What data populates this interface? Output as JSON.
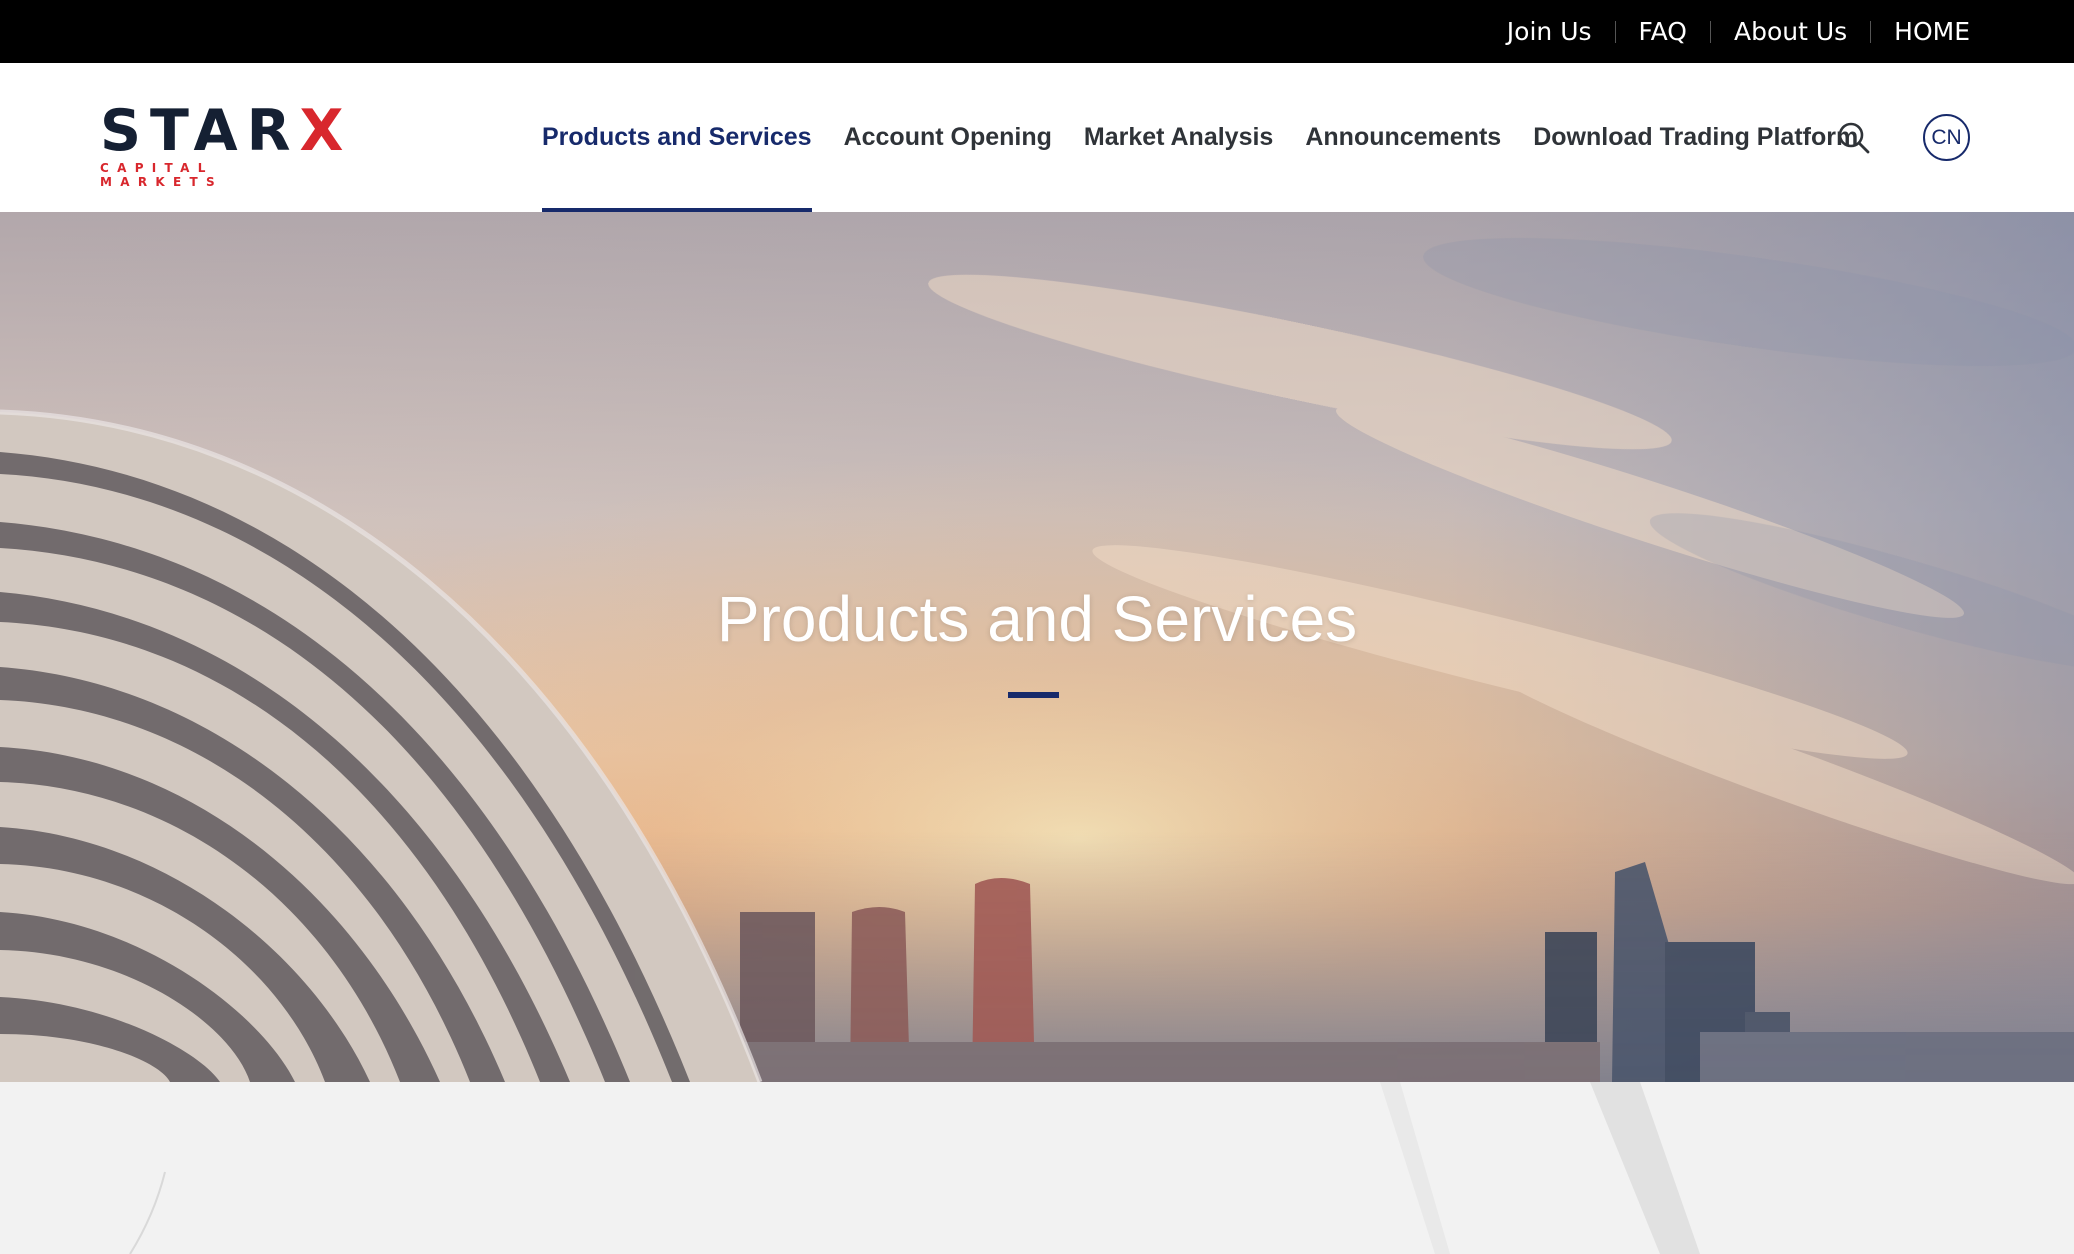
{
  "topbar": {
    "links": [
      "Join Us",
      "FAQ",
      "About Us",
      "HOME"
    ]
  },
  "logo": {
    "word_main": "STAR",
    "word_accent": "X",
    "tagline": "CAPITAL MARKETS"
  },
  "nav": {
    "items": [
      {
        "label": "Products and Services",
        "active": true
      },
      {
        "label": "Account Opening",
        "active": false
      },
      {
        "label": "Market Analysis",
        "active": false
      },
      {
        "label": "Announcements",
        "active": false
      },
      {
        "label": "Download Trading Platform",
        "active": false
      }
    ],
    "search_icon": "search-icon",
    "language_label": "CN"
  },
  "hero": {
    "title": "Products and Services"
  },
  "colors": {
    "brand_navy": "#172a6b",
    "brand_red": "#d8272d",
    "topbar_bg": "#000000"
  }
}
